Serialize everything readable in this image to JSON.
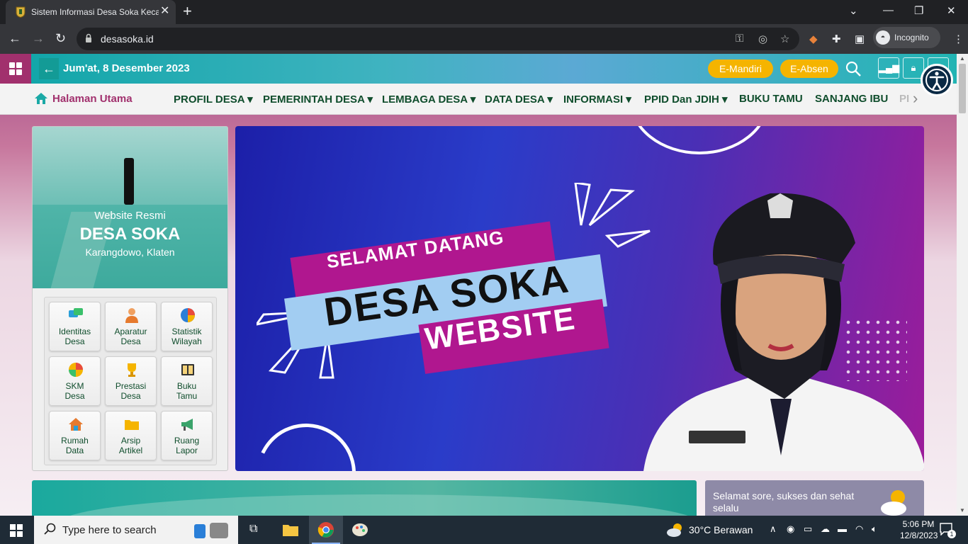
{
  "browser": {
    "tab_title": "Sistem Informasi Desa Soka Kecamatan Karangdowo",
    "url": "desasoka.id",
    "incognito_label": "Incognito"
  },
  "site": {
    "date": "Jum'at, 8 Desember 2023",
    "btn_mandiri": "E-Mandiri",
    "btn_absen": "E-Absen",
    "menu": {
      "home": "Halaman Utama",
      "items": [
        "PROFIL DESA",
        "PEMERINTAH DESA",
        "LEMBAGA DESA",
        "DATA DESA",
        "INFORMASI",
        "PPID Dan JDIH",
        "BUKU TAMU",
        "SANJANG IBU",
        "PI"
      ]
    },
    "panel": {
      "small": "Website Resmi",
      "big": "DESA SOKA",
      "sub": "Karangdowo, Klaten",
      "tiles": [
        {
          "line1": "Identitas",
          "line2": "Desa"
        },
        {
          "line1": "Aparatur",
          "line2": "Desa"
        },
        {
          "line1": "Statistik",
          "line2": "Wilayah"
        },
        {
          "line1": "SKM",
          "line2": "Desa"
        },
        {
          "line1": "Prestasi",
          "line2": "Desa"
        },
        {
          "line1": "Buku",
          "line2": "Tamu"
        },
        {
          "line1": "Rumah",
          "line2": "Data"
        },
        {
          "line1": "Arsip",
          "line2": "Artikel"
        },
        {
          "line1": "Ruang",
          "line2": "Lapor"
        }
      ]
    },
    "banner": {
      "line1": "SELAMAT DATANG",
      "line2": "DESA SOKA",
      "line3": "WEBSITE"
    },
    "greeting": "Selamat sore, sukses dan sehat selalu"
  },
  "taskbar": {
    "search_placeholder": "Type here to search",
    "weather": "30°C  Berawan",
    "time": "5:06 PM",
    "date": "12/8/2023",
    "notif_count": "1"
  },
  "colors": {
    "brand_magenta": "#a1306d",
    "brand_teal": "#0fa5a7",
    "accent_yellow": "#f5b400",
    "menu_text": "#0f4d2c"
  }
}
